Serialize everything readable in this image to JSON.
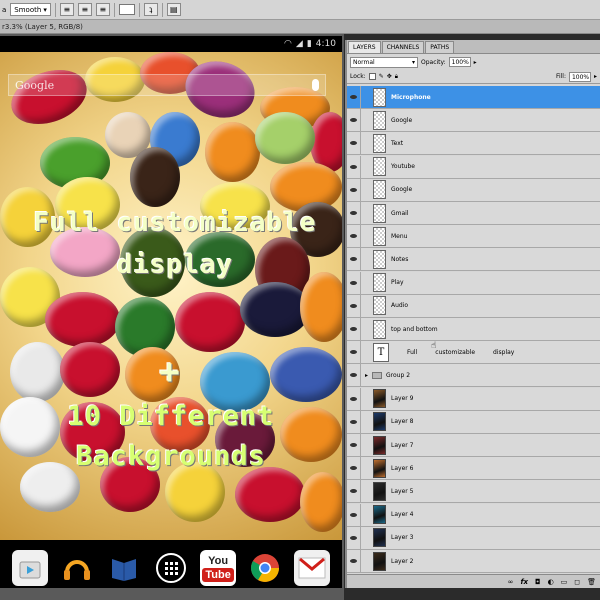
{
  "toolbar": {
    "antialias": "Smooth",
    "align_left": "≡",
    "align_center": "≡",
    "align_right": "≡"
  },
  "document": {
    "tab_title": "r3.3% (Layer 5, RGB/8)"
  },
  "phone": {
    "clock": "4:10",
    "search_placeholder": "Google",
    "overlay_line1": "Full customizable display",
    "overlay_plus": "+",
    "overlay_line2": "10 Different Backgrounds",
    "dock_apps": [
      "Play Store",
      "Play Music",
      "Play Books",
      "Apps",
      "YouTube",
      "Chrome",
      "Gmail"
    ],
    "youtube_label_top": "You",
    "youtube_label_bottom": "Tube"
  },
  "panel": {
    "tabs": [
      "LAYERS",
      "CHANNELS",
      "PATHS"
    ],
    "blend_mode": "Normal",
    "opacity_label": "Opacity:",
    "opacity_value": "100%",
    "lock_label": "Lock:",
    "fill_label": "Fill:",
    "fill_value": "100%",
    "layers": [
      {
        "name": "Microphone",
        "type": "shape",
        "selected": true
      },
      {
        "name": "Google",
        "type": "shape"
      },
      {
        "name": "Text",
        "type": "shape"
      },
      {
        "name": "Youtube",
        "type": "shape"
      },
      {
        "name": "Google",
        "type": "shape"
      },
      {
        "name": "Gmail",
        "type": "shape"
      },
      {
        "name": "Menu",
        "type": "shape"
      },
      {
        "name": "Notes",
        "type": "shape"
      },
      {
        "name": "Play",
        "type": "shape"
      },
      {
        "name": "Audio",
        "type": "shape"
      },
      {
        "name": "top and bottom",
        "type": "shape"
      },
      {
        "name": "Full     customizable     display",
        "type": "text",
        "words": [
          "Full",
          "customizable",
          "display"
        ],
        "glyph": "T"
      },
      {
        "name": "Group 2",
        "type": "group"
      },
      {
        "name": "Layer 9",
        "type": "image",
        "color": "#8a5a2a"
      },
      {
        "name": "Layer 8",
        "type": "image",
        "color": "#1c3a6a"
      },
      {
        "name": "Layer 7",
        "type": "image",
        "color": "#7a2a2a"
      },
      {
        "name": "Layer 6",
        "type": "image",
        "color": "#c07030"
      },
      {
        "name": "Layer 5",
        "type": "image",
        "color": "#2a2a2a"
      },
      {
        "name": "Layer 4",
        "type": "image",
        "color": "#1a6a8a"
      },
      {
        "name": "Layer 3",
        "type": "image",
        "color": "#203050"
      },
      {
        "name": "Layer 2",
        "type": "image",
        "color": "#3a2a1a"
      }
    ],
    "footer_icons": [
      "link-icon",
      "fx-icon",
      "mask-icon",
      "adjustment-icon",
      "folder-icon",
      "new-layer-icon",
      "trash-icon"
    ]
  }
}
